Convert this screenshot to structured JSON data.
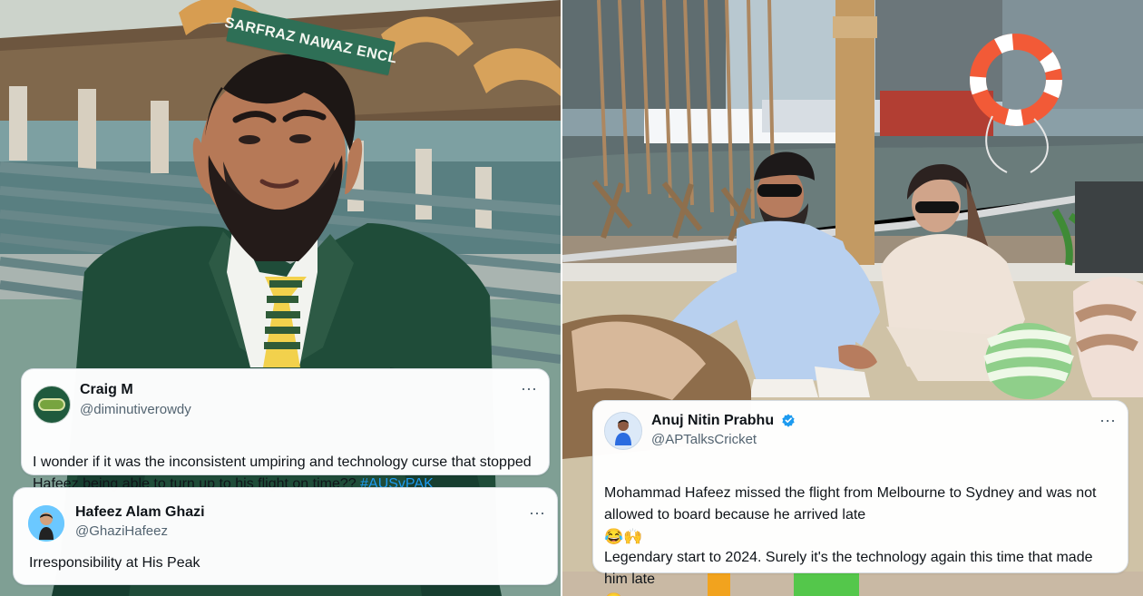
{
  "collage": {
    "left_photo": {
      "sign_text": "SARFRAZ NAWAZ ENCL"
    }
  },
  "tweets": [
    {
      "name": "Craig M",
      "handle": "@diminutiverowdy",
      "text_prefix": "I wonder if it was the inconsistent umpiring and technology curse that stopped Hafeez being able to turn up to his flight on time?? ",
      "hashtag": "#AUSvPAK",
      "more_icon": "more-horizontal-icon"
    },
    {
      "name": "Hafeez Alam Ghazi",
      "handle": "@GhaziHafeez",
      "text": "Irresponsibility at His Peak",
      "more_icon": "more-horizontal-icon"
    },
    {
      "name": "Anuj Nitin Prabhu",
      "handle": "@APTalksCricket",
      "text_line_1": "Mohammad Hafeez missed the flight from Melbourne to Sydney and was not allowed to board because he arrived late",
      "emoji_1": "😂🙌",
      "text_line_2": "Legendary start to 2024. Surely it's the technology again this time that made him late",
      "emoji_2": "🤭",
      "verified_icon": "verified-badge-icon",
      "more_icon": "more-horizontal-icon"
    }
  ],
  "colors": {
    "accent_blue": "#1d9bf0",
    "stadium_green": "#2e6f56",
    "handle_gray": "#536471"
  }
}
